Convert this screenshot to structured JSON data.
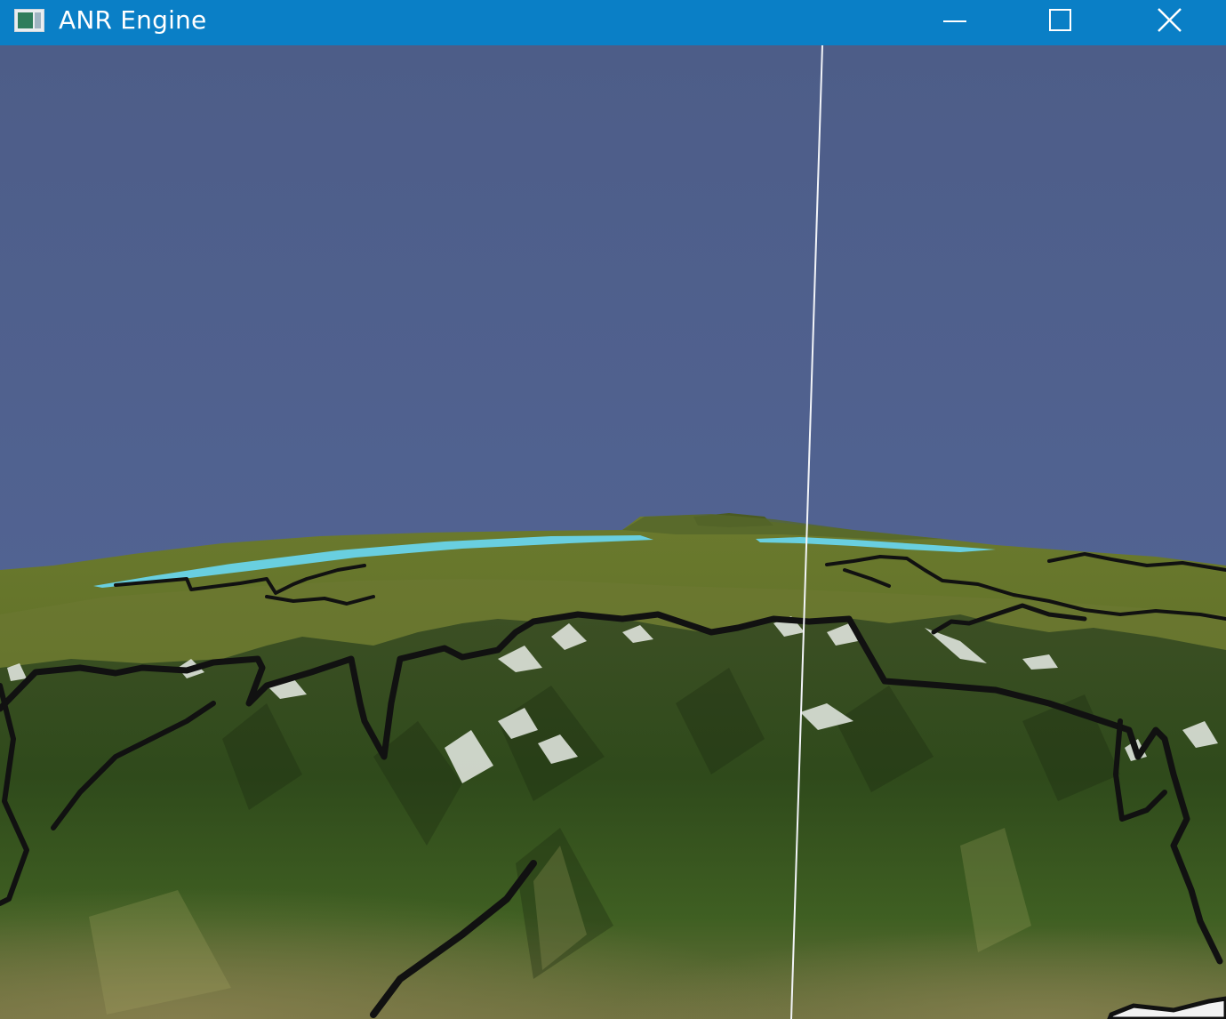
{
  "window": {
    "title": "ANR Engine",
    "titlebar_color": "#0a7fc6"
  },
  "controls": {
    "minimize_icon": "minimize-icon",
    "maximize_icon": "maximize-icon",
    "close_icon": "close-icon"
  },
  "scene": {
    "sky_color": "#4f5f8b",
    "water_color": "#69cfe0",
    "border_color": "#111111",
    "snow_color": "#e8ece6",
    "terrain_color": "#3d5a1f"
  }
}
